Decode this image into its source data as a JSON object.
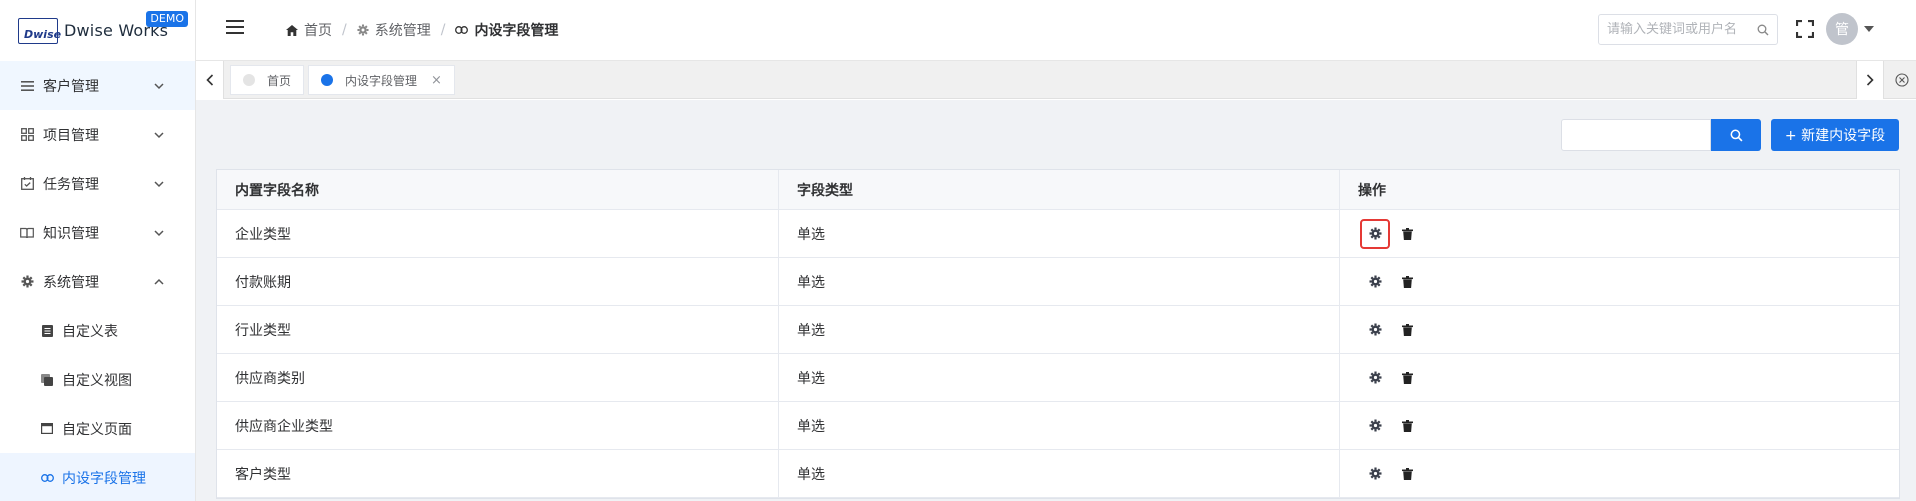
{
  "brand": {
    "logo_mark": "Dwise",
    "name": "Dwise Works",
    "badge": "DEMO"
  },
  "sidebar": {
    "items": [
      {
        "label": "客户管理",
        "icon": "list-icon"
      },
      {
        "label": "项目管理",
        "icon": "grid-icon"
      },
      {
        "label": "任务管理",
        "icon": "calendar-check-icon"
      },
      {
        "label": "知识管理",
        "icon": "book-icon"
      },
      {
        "label": "系统管理",
        "icon": "gear-icon"
      }
    ],
    "sub_items": [
      {
        "label": "自定义表",
        "icon": "table-doc-icon"
      },
      {
        "label": "自定义视图",
        "icon": "layers-icon"
      },
      {
        "label": "自定义页面",
        "icon": "window-icon"
      },
      {
        "label": "内设字段管理",
        "icon": "link-icon"
      }
    ]
  },
  "header": {
    "breadcrumb": [
      "首页",
      "系统管理",
      "内设字段管理"
    ],
    "search_placeholder": "请输入关键词或用户名",
    "avatar_text": "管"
  },
  "tabs": [
    {
      "label": "首页",
      "dot_color": "#e4e4e4"
    },
    {
      "label": "内设字段管理",
      "dot_color": "#1a73e8",
      "close": "×"
    }
  ],
  "toolbar": {
    "new_button": "+ 新建内设字段"
  },
  "table": {
    "columns": [
      "内置字段名称",
      "字段类型",
      "操作"
    ],
    "rows": [
      [
        "企业类型",
        "单选"
      ],
      [
        "付款账期",
        "单选"
      ],
      [
        "行业类型",
        "单选"
      ],
      [
        "供应商类别",
        "单选"
      ],
      [
        "供应商企业类型",
        "单选"
      ],
      [
        "客户类型",
        "单选"
      ]
    ]
  },
  "colors": {
    "accent": "#1a73e8",
    "highlight": "#e53935"
  }
}
